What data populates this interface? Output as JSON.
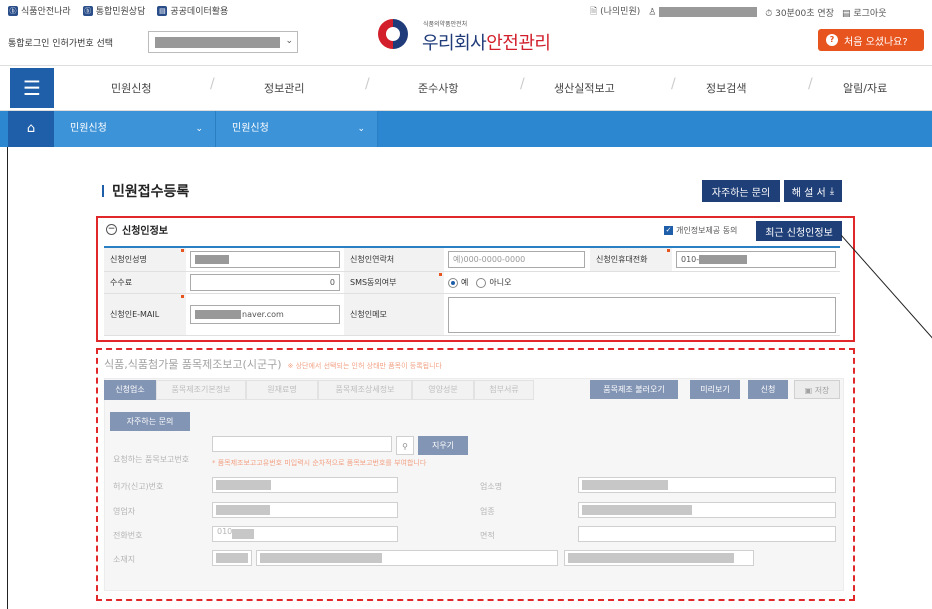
{
  "topbar": {
    "links": [
      {
        "icon": "doc-icon",
        "label": "식품안전나라"
      },
      {
        "icon": "doc-icon",
        "label": "통합민원상담"
      },
      {
        "icon": "monitor-icon",
        "label": "공공데이터활용"
      }
    ],
    "login_label": "통합로그인 인허가번호 선택",
    "my_petition": "(나의민원)",
    "session": "30분00초 연장",
    "logout": "로그아웃",
    "first_visit": "처음 오셨나요?"
  },
  "logo": {
    "sub": "식품의약품안전처",
    "main_blue": "우리회사",
    "main_red": "안전관리"
  },
  "nav": {
    "items": [
      "민원신청",
      "정보관리",
      "준수사항",
      "생산실적보고",
      "정보검색",
      "알림/자료"
    ]
  },
  "subnav": {
    "level1": "민원신청",
    "level2": "민원신청"
  },
  "page": {
    "title": "민원접수등록",
    "faq_button": "자주하는 문의",
    "manual_button": "해 설 서"
  },
  "applicant": {
    "section_title": "신청인정보",
    "consent_label": "개인정보제공 동의",
    "recent_button": "최근 신청인정보",
    "rows": {
      "name_label": "신청인성명",
      "contact_label": "신청인연락처",
      "contact_placeholder": "예)000-0000-0000",
      "mobile_label": "신청인휴대전화",
      "mobile_value": "010-",
      "fee_label": "수수료",
      "fee_value": "0",
      "sms_label": "SMS동의여부",
      "sms_yes": "예",
      "sms_no": "아니오",
      "email_label": "신청인E-MAIL",
      "email_value": "naver.com",
      "memo_label": "신청인메모"
    }
  },
  "report": {
    "title": "식품,식품첨가물 품목제조보고(시군구)",
    "note": "※ 상단에서 선택되는 인허 상태만 품목이 등록됩니다",
    "tabs": [
      "신청업소",
      "품목제조기본정보",
      "원재료명",
      "품목제조상세정보",
      "영양성분",
      "첨부서류"
    ],
    "actions": {
      "load": "품목제조 불러오기",
      "preview": "미리보기",
      "apply": "신청",
      "save": "저장"
    },
    "faq_button": "자주하는 문의",
    "search_label": "요청하는 품목보고번호",
    "clear_button": "지우기",
    "search_note": "* 품목제조보고고유번호 미입력시 순차적으로 품목보고번호를 부여합니다",
    "fields": {
      "license_label": "허가(신고)번호",
      "business_label": "업소명",
      "owner_label": "영업자",
      "type_label": "업종",
      "phone_label": "전화번호",
      "phone_value": "010",
      "area_label": "면적",
      "address_label": "소재지"
    }
  },
  "colors": {
    "navy": "#1f3f78",
    "blue": "#2d86d0",
    "red_highlight": "#e0282a",
    "orange": "#e8541e"
  }
}
